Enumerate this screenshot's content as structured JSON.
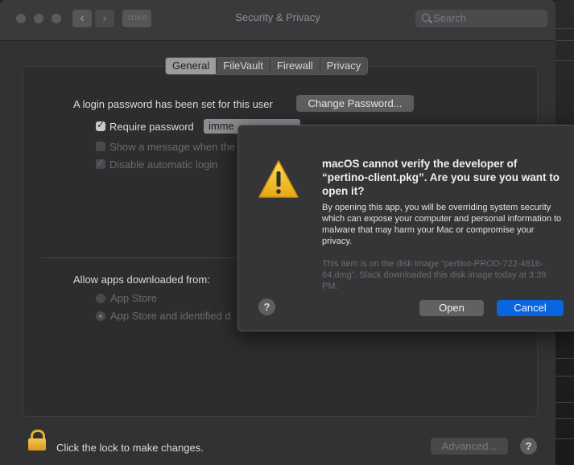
{
  "window": {
    "title": "Security & Privacy",
    "search_placeholder": "Search",
    "grid_icon": "grid-icon",
    "back_icon": "chevron-left-icon",
    "forward_icon": "chevron-right-icon"
  },
  "tabs": [
    {
      "label": "General",
      "selected": true
    },
    {
      "label": "FileVault",
      "selected": false
    },
    {
      "label": "Firewall",
      "selected": false
    },
    {
      "label": "Privacy",
      "selected": false
    }
  ],
  "general": {
    "login_password_text": "A login password has been set for this user",
    "change_password_label": "Change Password...",
    "require_password_label": "Require password",
    "require_password_value": "imme",
    "show_message_label": "Show a message when the",
    "disable_auto_login_label": "Disable automatic login",
    "allow_apps_label": "Allow apps downloaded from:",
    "radio_app_store": "App Store",
    "radio_app_store_identified": "App Store and identified d"
  },
  "footer": {
    "lock_text": "Click the lock to make changes.",
    "advanced_label": "Advanced...",
    "help_label": "?"
  },
  "dialog": {
    "title": "macOS cannot verify the developer of “pertino-client.pkg”. Are you sure you want to open it?",
    "body": "By opening this app, you will be overriding system security which can expose your computer and personal information to malware that may harm your Mac or compromise your privacy.",
    "info": "This item is on the disk image “pertino-PROD-722-4816-64.dmg”. Slack downloaded this disk image today at 3:39 PM.",
    "help_label": "?",
    "open_label": "Open",
    "cancel_label": "Cancel"
  },
  "colors": {
    "accent": "#0a65e0",
    "warning": "#f5c518",
    "lock": "#e4ae2f"
  }
}
